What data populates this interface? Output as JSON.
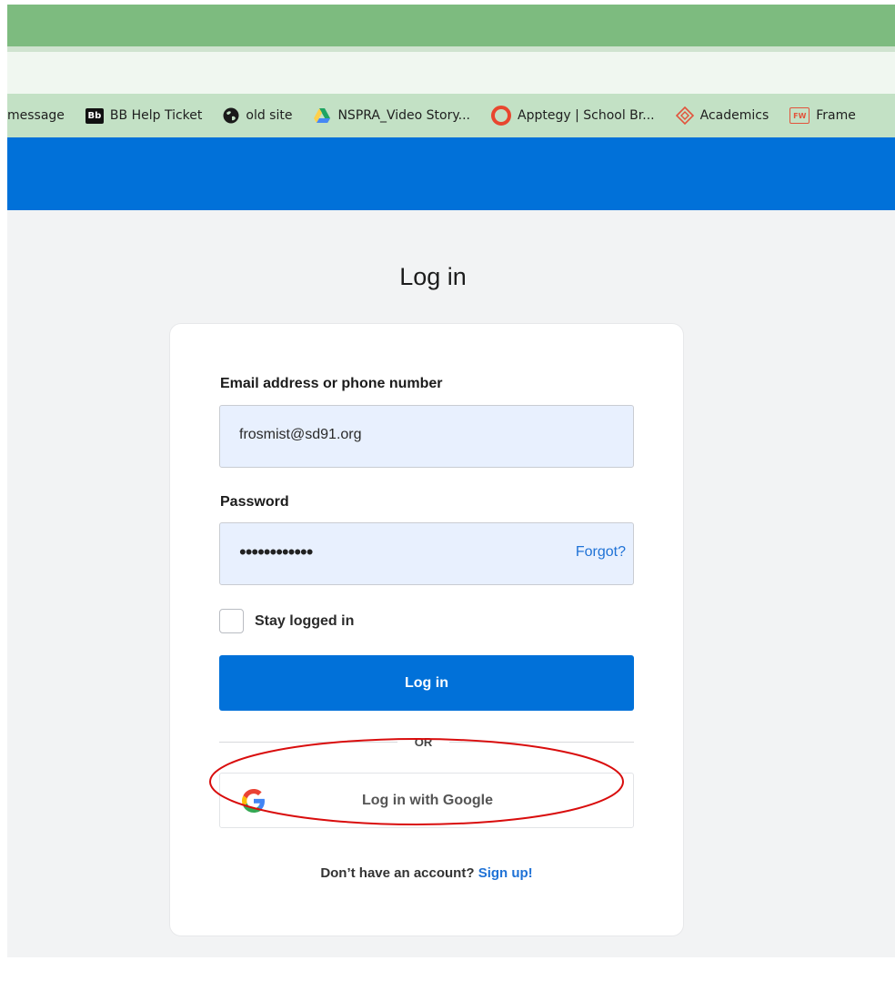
{
  "bookmarks": [
    {
      "label": "message",
      "icon": "none"
    },
    {
      "label": "BB Help Ticket",
      "icon": "blackboard-icon",
      "icon_text": "Bb"
    },
    {
      "label": "old site",
      "icon": "globe-icon"
    },
    {
      "label": "NSPRA_Video Story...",
      "icon": "google-drive-icon"
    },
    {
      "label": "Apptegy | School Br...",
      "icon": "apptegy-icon"
    },
    {
      "label": "Academics",
      "icon": "academics-icon"
    },
    {
      "label": "Frame",
      "icon": "fw-icon",
      "icon_text": "FW"
    }
  ],
  "login": {
    "title": "Log in",
    "email_label": "Email address or phone number",
    "email_value": "frosmist@sd91.org",
    "password_label": "Password",
    "password_mask": "••••••••••••",
    "forgot_label": "Forgot?",
    "stay_logged_in_label": "Stay logged in",
    "stay_logged_in_checked": false,
    "login_button_label": "Log in",
    "or_label": "OR",
    "google_button_label": "Log in with Google",
    "signup_prompt": "Don’t have an account?",
    "signup_link": "Sign up!"
  },
  "colors": {
    "brand_blue": "#0171d9",
    "browser_green": "#7dbb7f",
    "bookmarks_bg": "#c3e1c5",
    "annotation_red": "#d90d0d",
    "link_blue": "#1f72d6"
  }
}
